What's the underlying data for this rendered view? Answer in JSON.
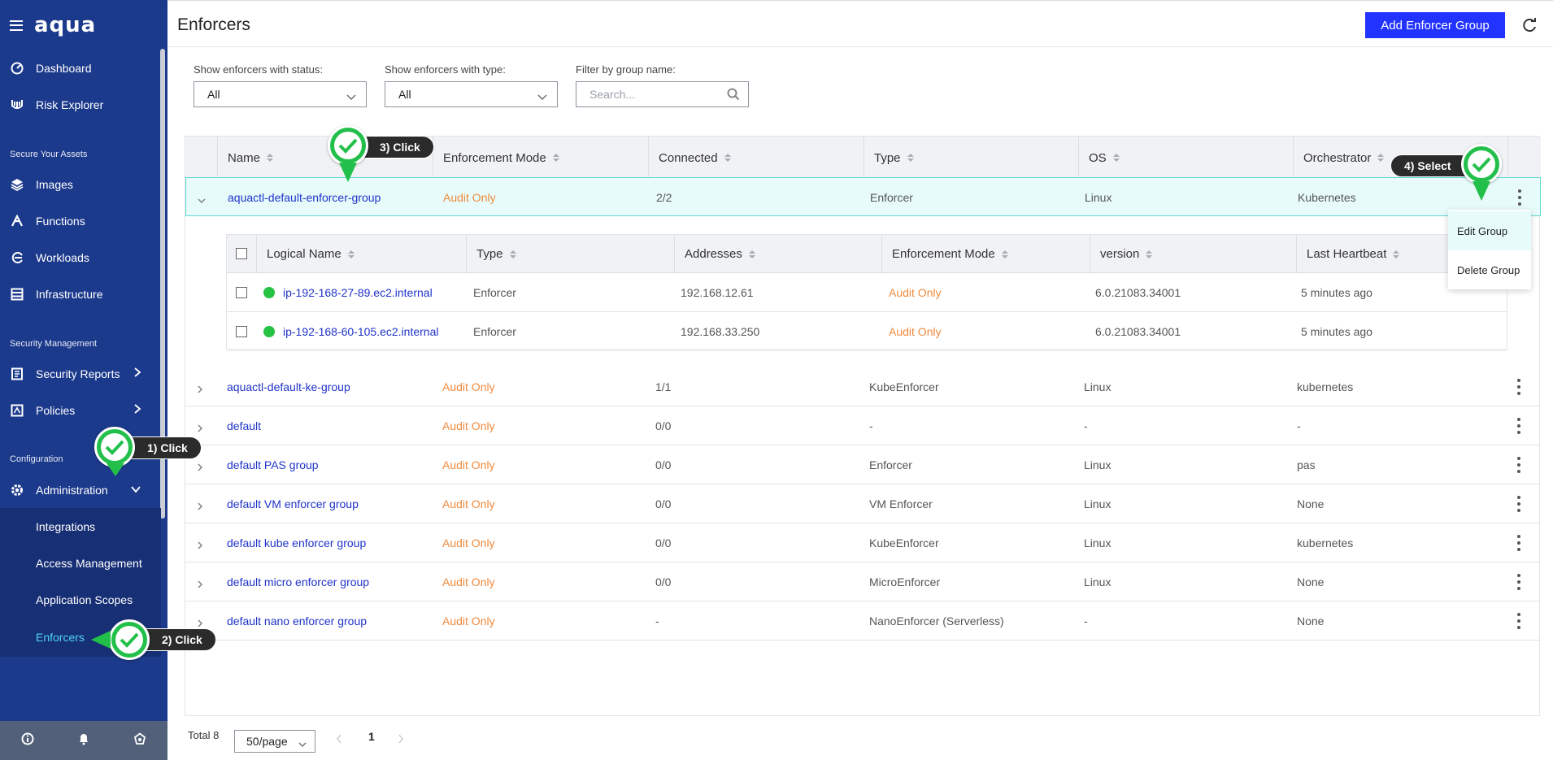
{
  "app": {
    "logo": "aqua"
  },
  "sidebar": {
    "items": [
      {
        "label": "Dashboard",
        "icon": "gauge-icon"
      },
      {
        "label": "Risk Explorer",
        "icon": "risk-explorer-icon"
      }
    ],
    "section_assets": "Secure Your Assets",
    "assets": [
      {
        "label": "Images",
        "icon": "layers-icon"
      },
      {
        "label": "Functions",
        "icon": "functions-icon"
      },
      {
        "label": "Workloads",
        "icon": "workloads-icon"
      },
      {
        "label": "Infrastructure",
        "icon": "infrastructure-icon"
      }
    ],
    "section_security": "Security Management",
    "security": [
      {
        "label": "Security Reports",
        "icon": "report-icon"
      },
      {
        "label": "Policies",
        "icon": "policy-icon"
      }
    ],
    "section_config": "Configuration",
    "admin_label": "Administration",
    "sub_items": [
      "Integrations",
      "Access Management",
      "Application Scopes",
      "Enforcers"
    ]
  },
  "header": {
    "title": "Enforcers",
    "add_button": "Add Enforcer Group"
  },
  "filters": {
    "status_label": "Show enforcers with status:",
    "status_value": "All",
    "type_label": "Show enforcers with type:",
    "type_value": "All",
    "group_label": "Filter by group name:",
    "group_placeholder": "Search..."
  },
  "table": {
    "headers": [
      "Name",
      "Enforcement Mode",
      "Connected",
      "Type",
      "OS",
      "Orchestrator"
    ],
    "rows": [
      {
        "name": "aquactl-default-enforcer-group",
        "mode": "Audit Only",
        "connected": "2/2",
        "type": "Enforcer",
        "os": "Linux",
        "orchestrator": "Kubernetes"
      },
      {
        "name": "aquactl-default-ke-group",
        "mode": "Audit Only",
        "connected": "1/1",
        "type": "KubeEnforcer",
        "os": "Linux",
        "orchestrator": "kubernetes"
      },
      {
        "name": "default",
        "mode": "Audit Only",
        "connected": "0/0",
        "type": "-",
        "os": "-",
        "orchestrator": "-"
      },
      {
        "name": "default PAS group",
        "mode": "Audit Only",
        "connected": "0/0",
        "type": "Enforcer",
        "os": "Linux",
        "orchestrator": "pas"
      },
      {
        "name": "default VM enforcer group",
        "mode": "Audit Only",
        "connected": "0/0",
        "type": "VM Enforcer",
        "os": "Linux",
        "orchestrator": "None"
      },
      {
        "name": "default kube enforcer group",
        "mode": "Audit Only",
        "connected": "0/0",
        "type": "KubeEnforcer",
        "os": "Linux",
        "orchestrator": "kubernetes"
      },
      {
        "name": "default micro enforcer group",
        "mode": "Audit Only",
        "connected": "0/0",
        "type": "MicroEnforcer",
        "os": "Linux",
        "orchestrator": "None"
      },
      {
        "name": "default nano enforcer group",
        "mode": "Audit Only",
        "connected": "-",
        "type": "NanoEnforcer (Serverless)",
        "os": "-",
        "orchestrator": "None"
      }
    ]
  },
  "nested": {
    "headers": [
      "Logical Name",
      "Type",
      "Addresses",
      "Enforcement Mode",
      "version",
      "Last Heartbeat"
    ],
    "rows": [
      {
        "name": "ip-192-168-27-89.ec2.internal",
        "type": "Enforcer",
        "address": "192.168.12.61",
        "mode": "Audit Only",
        "version": "6.0.21083.34001",
        "heartbeat": "5 minutes ago"
      },
      {
        "name": "ip-192-168-60-105.ec2.internal",
        "type": "Enforcer",
        "address": "192.168.33.250",
        "mode": "Audit Only",
        "version": "6.0.21083.34001",
        "heartbeat": "5 minutes ago"
      }
    ]
  },
  "menu": {
    "edit": "Edit Group",
    "delete": "Delete Group"
  },
  "pagination": {
    "total": "Total 8",
    "page_size": "50/page",
    "page": "1"
  },
  "callouts": {
    "c1": "1) Click",
    "c2": "2) Click",
    "c3": "3) Click",
    "c4": "4) Select"
  },
  "colors": {
    "sidebar": "#1c3a8c",
    "accent": "#2233ff",
    "link": "#1f33c8",
    "audit": "#f08a3c",
    "status_ok": "#25c244",
    "callout": "#22c04a"
  }
}
